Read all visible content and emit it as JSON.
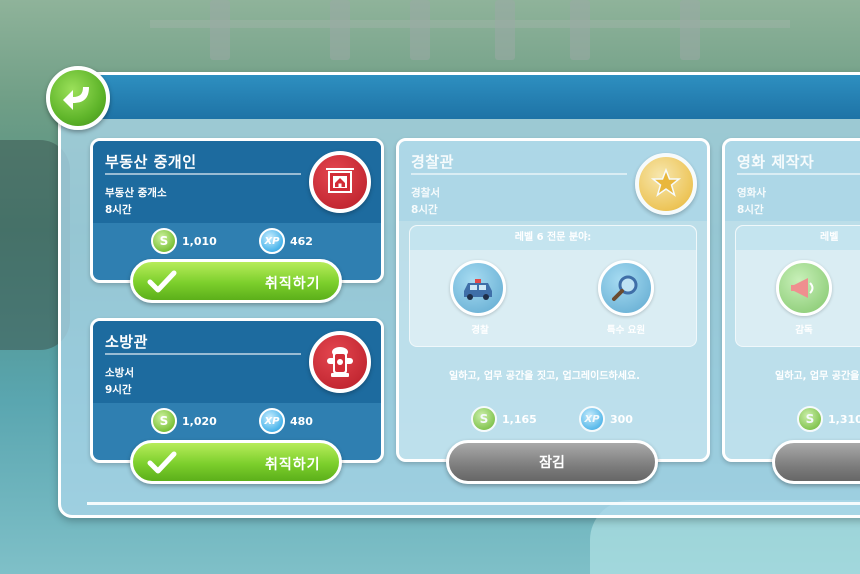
{
  "jobs": [
    {
      "title": "부동산 중개인",
      "workplace": "부동산 중개소",
      "hours": "8시간",
      "coins": "1,010",
      "xp": "462",
      "icon": "house-sign-icon",
      "button": "취직하기",
      "locked": false
    },
    {
      "title": "소방관",
      "workplace": "소방서",
      "hours": "9시간",
      "coins": "1,020",
      "xp": "480",
      "icon": "fire-hydrant-icon",
      "button": "취직하기",
      "locked": false
    },
    {
      "title": "경찰관",
      "workplace": "경찰서",
      "hours": "8시간",
      "coins": "1,165",
      "xp": "300",
      "icon": "police-badge-icon",
      "specialization_header": "레벨 6 전문 분야:",
      "specializations": [
        "경찰",
        "특수 요원"
      ],
      "unlock_text": "일하고, 업무 공간을 짓고, 업그레이드하세요.",
      "button": "잠김",
      "locked": true
    },
    {
      "title": "영화 제작자",
      "workplace": "영화사",
      "hours": "8시간",
      "coins": "1,310",
      "icon": "megaphone-icon",
      "specialization_header": "레벨",
      "specializations": [
        "감독"
      ],
      "unlock_text": "일하고, 업무 공간을",
      "locked": true
    }
  ],
  "xp_badge": "XP",
  "coin_symbol": "S",
  "colors": {
    "header_blue": "#1e73a6",
    "button_green": "#7ccf2c",
    "button_gray": "#7d7d7d"
  }
}
